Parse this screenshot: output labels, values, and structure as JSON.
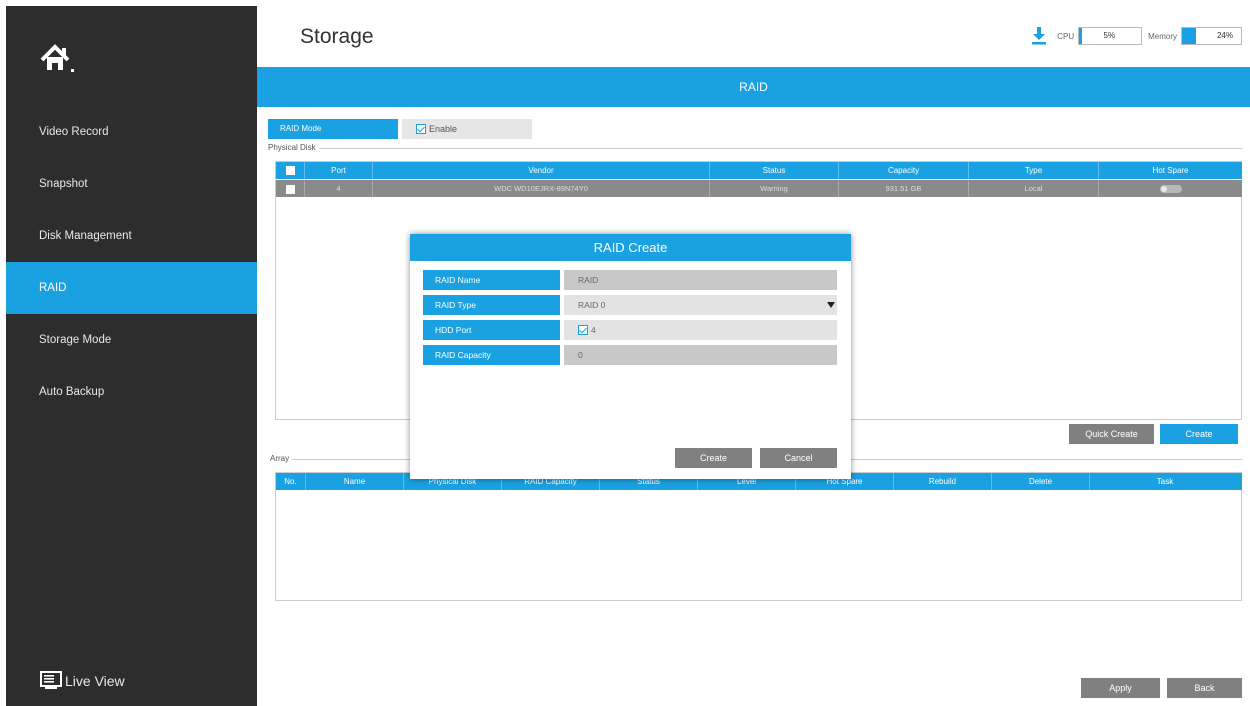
{
  "sidebar": {
    "items": [
      {
        "label": "Video Record"
      },
      {
        "label": "Snapshot"
      },
      {
        "label": "Disk Management"
      },
      {
        "label": "RAID"
      },
      {
        "label": "Storage Mode"
      },
      {
        "label": "Auto Backup"
      }
    ],
    "active_index": 3,
    "live_view": "Live View"
  },
  "header": {
    "title": "Storage",
    "cpu_label": "CPU",
    "cpu_value": "5%",
    "cpu_percent": 5,
    "memory_label": "Memory",
    "memory_value": "24%",
    "memory_percent": 24
  },
  "banner": {
    "title": "RAID"
  },
  "raid_mode": {
    "label": "RAID Mode",
    "enable_label": "Enable",
    "enabled": true
  },
  "physical_disk": {
    "group_label": "Physical Disk",
    "columns": [
      "Port",
      "Vendor",
      "Status",
      "Capacity",
      "Type",
      "Hot Spare"
    ],
    "rows": [
      {
        "port": "4",
        "vendor": "WDC WD10EJRX-89N74Y0",
        "status": "Warning",
        "capacity": "931.51 GB",
        "type": "Local"
      }
    ]
  },
  "actions": {
    "quick_create": "Quick Create",
    "create": "Create"
  },
  "array": {
    "group_label": "Array",
    "columns": [
      "No.",
      "Name",
      "Physical Disk",
      "RAID Capacity",
      "Status",
      "Level",
      "Hot Spare",
      "Rebuild",
      "Delete",
      "Task"
    ]
  },
  "modal": {
    "title": "RAID Create",
    "fields": [
      {
        "label": "RAID Name",
        "value": "RAID"
      },
      {
        "label": "RAID Type",
        "value": "RAID 0"
      },
      {
        "label": "HDD Port",
        "value": "4"
      },
      {
        "label": "RAID Capacity",
        "value": "0"
      }
    ],
    "create": "Create",
    "cancel": "Cancel"
  },
  "footer": {
    "apply": "Apply",
    "back": "Back"
  },
  "colors": {
    "accent": "#1aa1e1",
    "sidebar": "#2d2d2d",
    "button_gray": "#808080"
  }
}
